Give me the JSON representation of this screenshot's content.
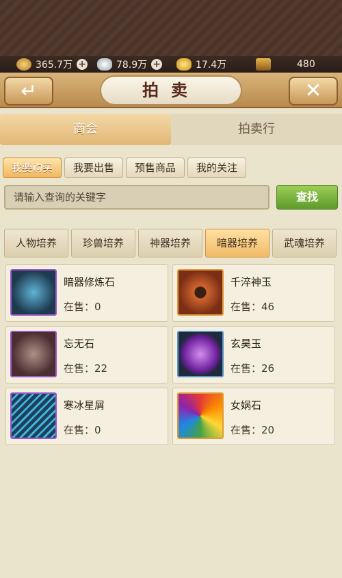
{
  "currency": [
    {
      "icon": "copper-coin-icon",
      "value": "365.7万",
      "addable": true
    },
    {
      "icon": "silver-ingot-icon",
      "value": "78.9万",
      "addable": true
    },
    {
      "icon": "gold-ingot-icon",
      "value": "17.4万",
      "addable": false
    },
    {
      "icon": "treasure-chest-icon",
      "value": "480",
      "addable": false
    }
  ],
  "header": {
    "title": "拍卖",
    "back_icon": "back-arrow-icon",
    "close_icon": "close-icon"
  },
  "main_tabs": [
    {
      "label": "商会",
      "active": true
    },
    {
      "label": "拍卖行",
      "active": false
    }
  ],
  "sub_tabs": [
    {
      "label": "我要购买",
      "active": true
    },
    {
      "label": "我要出售",
      "active": false
    },
    {
      "label": "预售商品",
      "active": false
    },
    {
      "label": "我的关注",
      "active": false
    }
  ],
  "search": {
    "placeholder": "请输入查询的关键字",
    "button_label": "查找"
  },
  "categories": [
    {
      "label": "人物培养",
      "active": false
    },
    {
      "label": "珍兽培养",
      "active": false
    },
    {
      "label": "神器培养",
      "active": false
    },
    {
      "label": "暗器培养",
      "active": true
    },
    {
      "label": "武魂培养",
      "active": false
    }
  ],
  "items": [
    {
      "name": "暗器修炼石",
      "stock_label": "在售：0",
      "frame": "purple",
      "icon": "blue-crystal-icon"
    },
    {
      "name": "千淬神玉",
      "stock_label": "在售：46",
      "frame": "orange",
      "icon": "jade-disc-icon"
    },
    {
      "name": "忘无石",
      "stock_label": "在售：22",
      "frame": "purple",
      "icon": "engraved-stone-icon"
    },
    {
      "name": "玄昊玉",
      "stock_label": "在售：26",
      "frame": "blue",
      "icon": "purple-orb-icon"
    },
    {
      "name": "寒冰星屑",
      "stock_label": "在售：0",
      "frame": "purple",
      "icon": "ice-shards-icon"
    },
    {
      "name": "女娲石",
      "stock_label": "在售：20",
      "frame": "orange",
      "icon": "rainbow-stone-icon"
    }
  ],
  "colors": {
    "panel_bg": "#ebe4cd",
    "active_tab": "#f0b860",
    "search_btn": "#6aa632"
  }
}
